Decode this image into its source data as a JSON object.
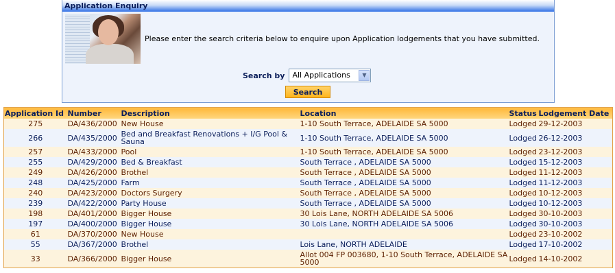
{
  "panel": {
    "title": "Application Enquiry",
    "intro": "Please enter the search criteria below to enquire upon Application lodgements that you have submitted.",
    "search_label": "Search by",
    "search_value": "All Applications",
    "search_button": "Search"
  },
  "table": {
    "headers": [
      "Application Id",
      "Number",
      "Description",
      "Location",
      "Status",
      "Lodgement Date"
    ],
    "rows": [
      {
        "id": "275",
        "number": "DA/436/2000",
        "description": "New House",
        "location": "1-10 South Terrace, ADELAIDE SA 5000",
        "status": "Lodged",
        "date": "29-12-2003"
      },
      {
        "id": "266",
        "number": "DA/435/2000",
        "description": "Bed and Breakfast Renovations + I/G Pool & Sauna",
        "location": "1-10 South Terrace, ADELAIDE SA 5000",
        "status": "Lodged",
        "date": "26-12-2003"
      },
      {
        "id": "257",
        "number": "DA/433/2000",
        "description": "Pool",
        "location": "1-10 South Terrace, ADELAIDE SA 5000",
        "status": "Lodged",
        "date": "23-12-2003"
      },
      {
        "id": "255",
        "number": "DA/429/2000",
        "description": "Bed & Breakfast",
        "location": "South Terrace , ADELAIDE SA 5000",
        "status": "Lodged",
        "date": "15-12-2003"
      },
      {
        "id": "249",
        "number": "DA/426/2000",
        "description": "Brothel",
        "location": "South Terrace , ADELAIDE SA 5000",
        "status": "Lodged",
        "date": "11-12-2003"
      },
      {
        "id": "248",
        "number": "DA/425/2000",
        "description": "Farm",
        "location": "South Terrace , ADELAIDE SA 5000",
        "status": "Lodged",
        "date": "11-12-2003"
      },
      {
        "id": "240",
        "number": "DA/423/2000",
        "description": "Doctors Surgery",
        "location": "South Terrace , ADELAIDE SA 5000",
        "status": "Lodged",
        "date": "10-12-2003"
      },
      {
        "id": "239",
        "number": "DA/422/2000",
        "description": "Party House",
        "location": "South Terrace , ADELAIDE SA 5000",
        "status": "Lodged",
        "date": "10-12-2003"
      },
      {
        "id": "198",
        "number": "DA/401/2000",
        "description": "Bigger House",
        "location": "30 Lois Lane, NORTH ADELAIDE SA 5006",
        "status": "Lodged",
        "date": "30-10-2003"
      },
      {
        "id": "197",
        "number": "DA/400/2000",
        "description": "Bigger House",
        "location": "30 Lois Lane, NORTH ADELAIDE SA 5006",
        "status": "Lodged",
        "date": "30-10-2003"
      },
      {
        "id": "61",
        "number": "DA/370/2000",
        "description": "New House",
        "location": "",
        "status": "Lodged",
        "date": "23-10-2002"
      },
      {
        "id": "55",
        "number": "DA/367/2000",
        "description": "Brothel",
        "location": "Lois Lane, NORTH ADELAIDE",
        "status": "Lodged",
        "date": "17-10-2002"
      },
      {
        "id": "33",
        "number": "DA/366/2000",
        "description": "Bigger House",
        "location": "Allot 004 FP 003680, 1-10 South Terrace, ADELAIDE SA 5000",
        "status": "Lodged",
        "date": "14-10-2002"
      }
    ]
  }
}
